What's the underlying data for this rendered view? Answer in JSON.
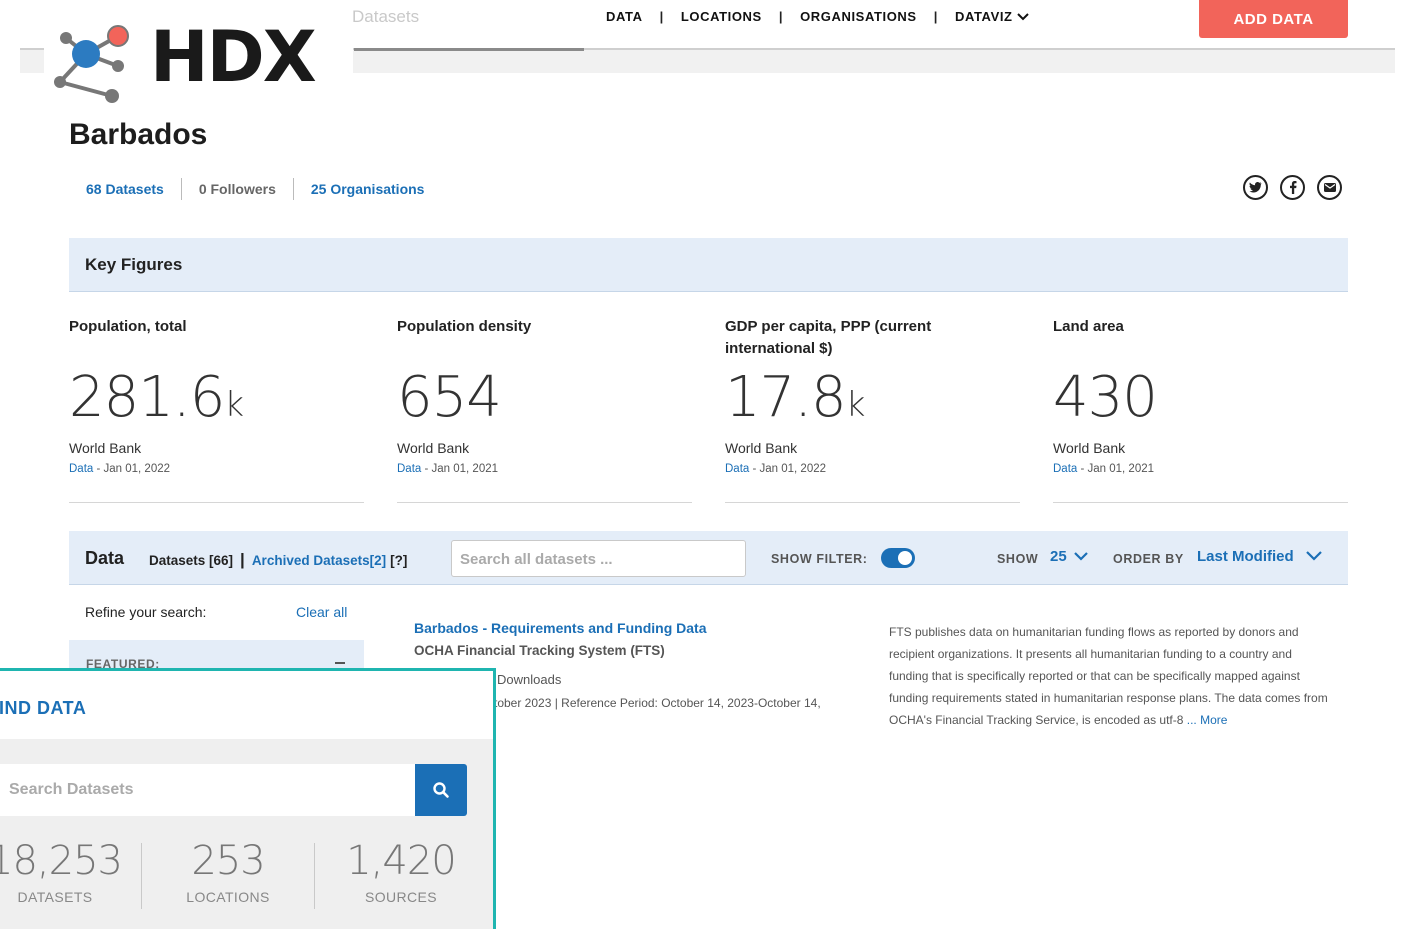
{
  "header": {
    "logo_text": "HDX",
    "search_ghost": "Datasets",
    "nav": [
      {
        "label": "DATA"
      },
      {
        "label": "LOCATIONS"
      },
      {
        "label": "ORGANISATIONS"
      },
      {
        "label": "DATAVIZ"
      }
    ],
    "add_button": "ADD DATA"
  },
  "page": {
    "title": "Barbados",
    "datasets": "68 Datasets",
    "followers": "0 Followers",
    "organisations": "25 Organisations",
    "social_icons": [
      "twitter-icon",
      "facebook-icon",
      "email-icon"
    ]
  },
  "key_figures": {
    "heading": "Key Figures",
    "items": [
      {
        "label": "Population, total",
        "value": "281.6",
        "unit": "k",
        "source": "World Bank",
        "data_link": "Data",
        "date": " - Jan 01, 2022"
      },
      {
        "label": "Population density",
        "value": "654",
        "unit": "",
        "source": "World Bank",
        "data_link": "Data",
        "date": " - Jan 01, 2021"
      },
      {
        "label": "GDP per capita, PPP (current international $)",
        "value": "17.8",
        "unit": "k",
        "source": "World Bank",
        "data_link": "Data",
        "date": " - Jan 01, 2022"
      },
      {
        "label": "Land area",
        "value": "430",
        "unit": "",
        "source": "World Bank",
        "data_link": "Data",
        "date": " - Jan 01, 2021"
      }
    ]
  },
  "data_section": {
    "title": "Data",
    "datasets_tab": "Datasets [66]",
    "archived_tab": "Archived Datasets[2]",
    "help": "[?]",
    "search_placeholder": "Search all datasets ...",
    "show_filter_label": "SHOW FILTER:",
    "show_filter_on": true,
    "show_label": "SHOW",
    "show_value": "25",
    "order_label": "ORDER BY",
    "order_value": "Last Modified"
  },
  "refine": {
    "label": "Refine your search:",
    "clear": "Clear all",
    "featured": "FEATURED:"
  },
  "result": {
    "title": "Barbados - Requirements and Funding Data",
    "org": "OCHA Financial Tracking System (FTS)",
    "downloads": "Downloads",
    "dates": "tober 2023 | Reference Period: October 14, 2023-October 14,",
    "description": "FTS publishes data on humanitarian funding flows as reported by donors and recipient organizations. It presents all humanitarian funding to a country and funding that is specifically reported or that can be specifically mapped against funding requirements stated in humanitarian response plans. The data comes from OCHA's Financial Tracking Service, is encoded as utf-8",
    "more": " ... More"
  },
  "find_panel": {
    "heading": "IND DATA",
    "search_placeholder": "Search Datasets",
    "stats": [
      {
        "value": "18,253",
        "label": "DATASETS"
      },
      {
        "value": "253",
        "label": "LOCATIONS"
      },
      {
        "value": "1,420",
        "label": "SOURCES"
      }
    ]
  },
  "colors": {
    "brand_blue": "#1b6fb6",
    "add_button": "#f2645a",
    "panel_border": "#1fb5b0",
    "section_bg": "#e4edf8"
  }
}
